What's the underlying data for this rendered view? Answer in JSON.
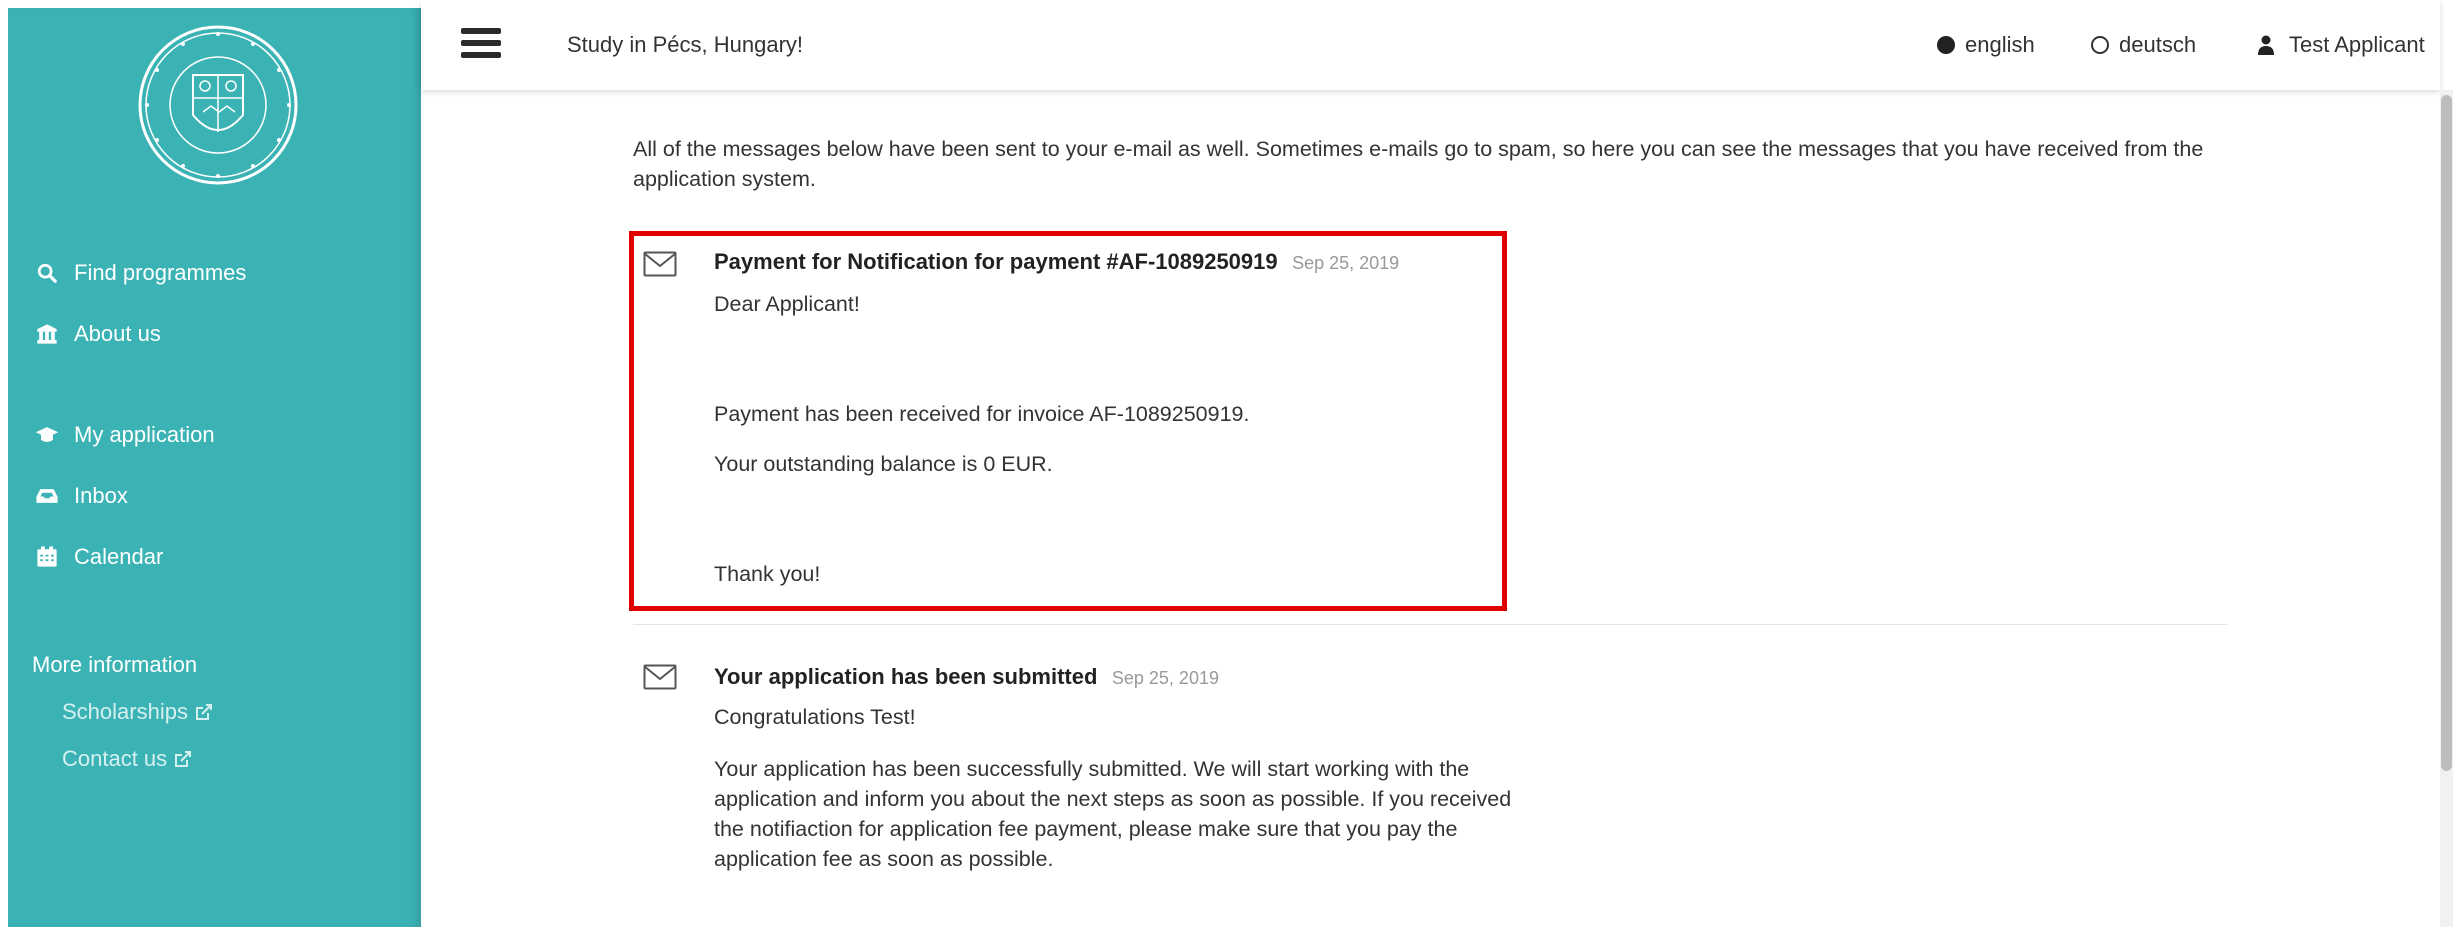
{
  "topbar": {
    "title": "Study in Pécs, Hungary!",
    "languages": [
      {
        "label": "english",
        "selected": true
      },
      {
        "label": "deutsch",
        "selected": false
      }
    ],
    "user": "Test Applicant"
  },
  "sidebar": {
    "logo_icon": "university-seal-logo",
    "items": [
      {
        "label": "Find programmes",
        "icon": "search-icon"
      },
      {
        "label": "About us",
        "icon": "institution-icon"
      },
      {
        "label": "My application",
        "icon": "graduation-cap-icon"
      },
      {
        "label": "Inbox",
        "icon": "inbox-icon"
      },
      {
        "label": "Calendar",
        "icon": "calendar-icon"
      }
    ],
    "more_heading": "More information",
    "more_links": [
      {
        "label": "Scholarships",
        "icon": "external-link-icon"
      },
      {
        "label": "Contact us",
        "icon": "external-link-icon"
      }
    ]
  },
  "main": {
    "intro": "All of the messages below have been sent to your e-mail as well. Sometimes e-mails go to spam, so here you can see the messages that you have received from the application system.",
    "messages": [
      {
        "icon": "envelope-icon",
        "subject": "Payment for Notification for payment #AF-1089250919",
        "date": "Sep 25, 2019",
        "paragraphs": [
          "Dear Applicant!",
          "Payment has been received for invoice AF-1089250919.",
          "Your outstanding balance is 0 EUR.",
          "Thank you!"
        ]
      },
      {
        "icon": "envelope-icon",
        "subject": "Your application has been submitted",
        "date": "Sep 25, 2019",
        "paragraphs": [
          "Congratulations Test!",
          "Your application has been successfully submitted. We will start working with the application and inform you about the next steps as soon as possible. If you received the notifiaction for application fee payment, please make sure that you pay the application fee as soon as possible."
        ]
      }
    ]
  },
  "colors": {
    "sidebar": "#3bb3b5",
    "highlight": "#e00000"
  }
}
